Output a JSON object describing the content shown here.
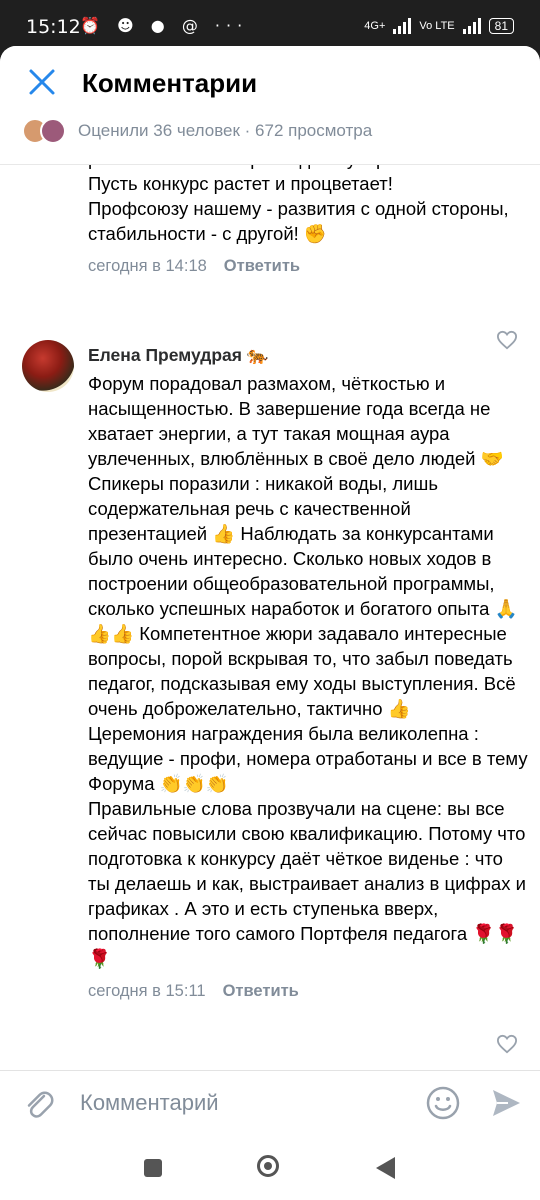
{
  "status_bar": {
    "time": "15:12",
    "status_icons": "⏰ ☻ ● @ ···",
    "net_label_1": "4G+",
    "net_label_2": "Vo LTE",
    "battery": "81"
  },
  "header": {
    "title": "Комментарии",
    "likes_text": "Оценили 36 человек · 672 просмотра"
  },
  "comment1": {
    "text": "регионов нашей страны дали уверенность в себе!\nПусть конкурс растет и процветает!\nПрофсоюзу нашему - развития с одной стороны, стабильности - с другой! ✊",
    "time": "сегодня в 14:18",
    "reply": "Ответить"
  },
  "comment2": {
    "author": "Елена Премудрая 🐅",
    "text": "Форум порадовал размахом, чёткостью и насыщенностью. В завершение года всегда не хватает энергии, а тут такая мощная аура увлеченных, влюблённых в своё дело людей 🤝 Спикеры поразили : никакой воды, лишь содержательная речь с качественной презентацией 👍 Наблюдать за конкурсантами было очень интересно. Сколько новых ходов в построении общеобразовательной программы, сколько успешных наработок и богатого опыта 🙏👍👍 Компетентное жюри задавало интересные вопросы, порой вскрывая то, что забыл поведать педагог, подсказывая ему ходы выступления. Всё очень доброжелательно, тактично 👍\nЦеремония награждения была великолепна : ведущие - профи, номера отработаны и все в тему Форума 👏👏👏\nПравильные слова прозвучали на сцене: вы все сейчас повысили свою квалификацию. Потому что подготовка к конкурсу даёт чёткое виденье : что ты делаешь и как, выстраивает анализ в цифрах и графиках . А это и есть ступенька вверх, пополнение того самого Портфеля педагога 🌹🌹🌹",
    "time": "сегодня в 15:11",
    "reply": "Ответить"
  },
  "input": {
    "placeholder": "Комментарий"
  },
  "colors": {
    "accent": "#2688eb",
    "secondary_text": "#818c99"
  }
}
